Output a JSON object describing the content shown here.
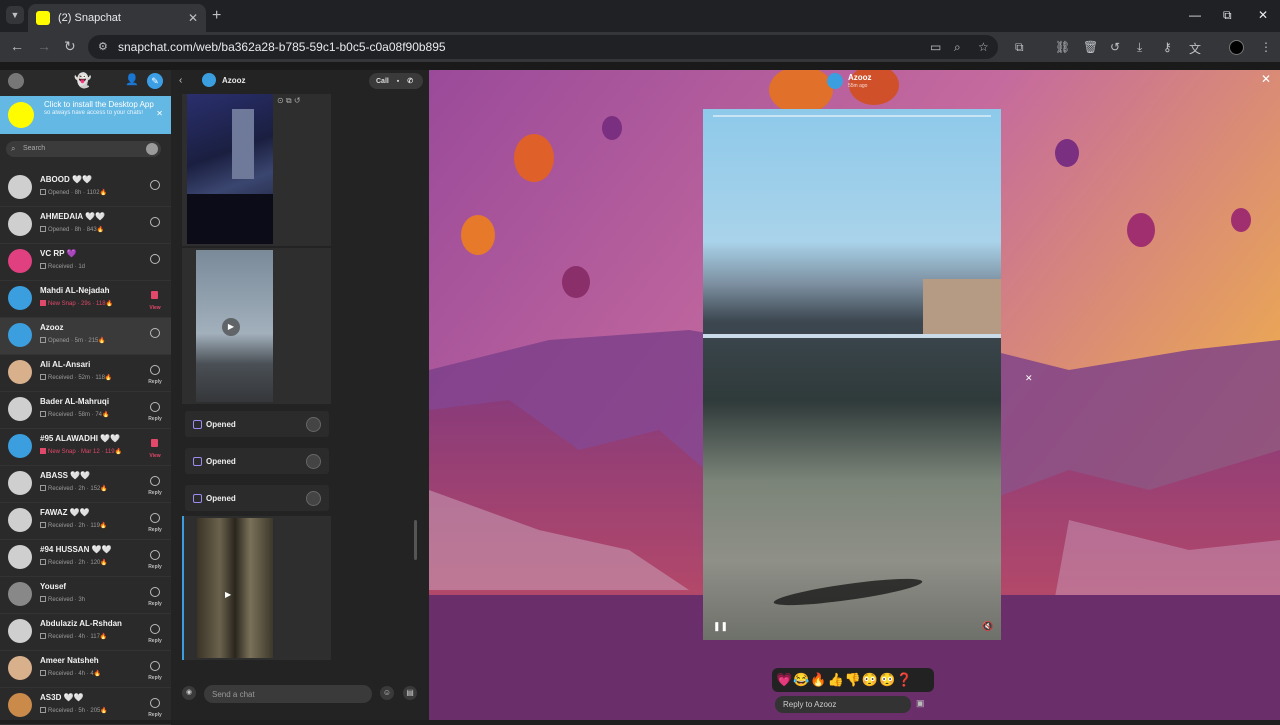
{
  "browser": {
    "tab_title": "(2) Snapchat",
    "tab_close": "✕",
    "new_tab": "+",
    "url": "snapchat.com/web/ba362a28-b785-59c1-b0c5-c0a08f90b895",
    "window": {
      "minimize": "—",
      "maximize": "⧉",
      "close": "✕"
    }
  },
  "banner": {
    "title": "Click to install the Desktop App",
    "subtitle": "so always have access to your chats!"
  },
  "search": {
    "placeholder": "Search"
  },
  "chats": [
    {
      "name": "ABOOD 🤍🤍",
      "status": "Opened · 8h · 1102🔥",
      "action": "",
      "type": "opened"
    },
    {
      "name": "AHMEDAIA 🤍🤍",
      "status": "Opened · 8h · 843🔥",
      "action": "",
      "type": "opened"
    },
    {
      "name": "VC RP 💜",
      "status": "Received · 1d",
      "action": "",
      "type": "received"
    },
    {
      "name": "Mahdi AL-Nejadah",
      "status": "New Snap · 29s · 118🔥",
      "action": "View",
      "type": "new"
    },
    {
      "name": "Azooz",
      "status": "Opened · 5m · 215🔥",
      "action": "",
      "type": "opened"
    },
    {
      "name": "Ali AL-Ansari",
      "status": "Received · 52m · 118🔥",
      "action": "Reply",
      "type": "received"
    },
    {
      "name": "Bader AL-Mahruqi",
      "status": "Received · 58m · 74🔥",
      "action": "Reply",
      "type": "received"
    },
    {
      "name": "#95 ALAWADHI 🤍🤍",
      "status": "New Snap · Mar 12 · 119🔥",
      "action": "View",
      "type": "new"
    },
    {
      "name": "ABASS 🤍🤍",
      "status": "Received · 2h · 152🔥",
      "action": "Reply",
      "type": "received"
    },
    {
      "name": "FAWAZ 🤍🤍",
      "status": "Received · 2h · 119🔥",
      "action": "Reply",
      "type": "received"
    },
    {
      "name": "#94 HUSSAN 🤍🤍",
      "status": "Received · 2h · 120🔥",
      "action": "Reply",
      "type": "received"
    },
    {
      "name": "Yousef",
      "status": "Received · 3h",
      "action": "Reply",
      "type": "received"
    },
    {
      "name": "Abdulaziz AL-Rshdan",
      "status": "Received · 4h · 117🔥",
      "action": "Reply",
      "type": "received"
    },
    {
      "name": "Ameer Natsheh",
      "status": "Received · 4h · 4🔥",
      "action": "Reply",
      "type": "received"
    },
    {
      "name": "AS3D 🤍🤍",
      "status": "Received · 5h · 205🔥",
      "action": "Reply",
      "type": "received"
    }
  ],
  "conversation": {
    "name": "Azooz",
    "call_label": "Call",
    "opened_items": [
      "Opened",
      "Opened",
      "Opened"
    ],
    "compose_placeholder": "Send a chat"
  },
  "snap_viewer": {
    "sender": "Azooz",
    "time_ago": "55m ago",
    "reactions": "💗😂🔥👍👎😳😳❓",
    "reply_placeholder": "Reply to Azooz"
  },
  "colors": {
    "banner": "#64b8e4",
    "snap_yellow": "#fffc00",
    "new_snap": "#e1486a"
  }
}
